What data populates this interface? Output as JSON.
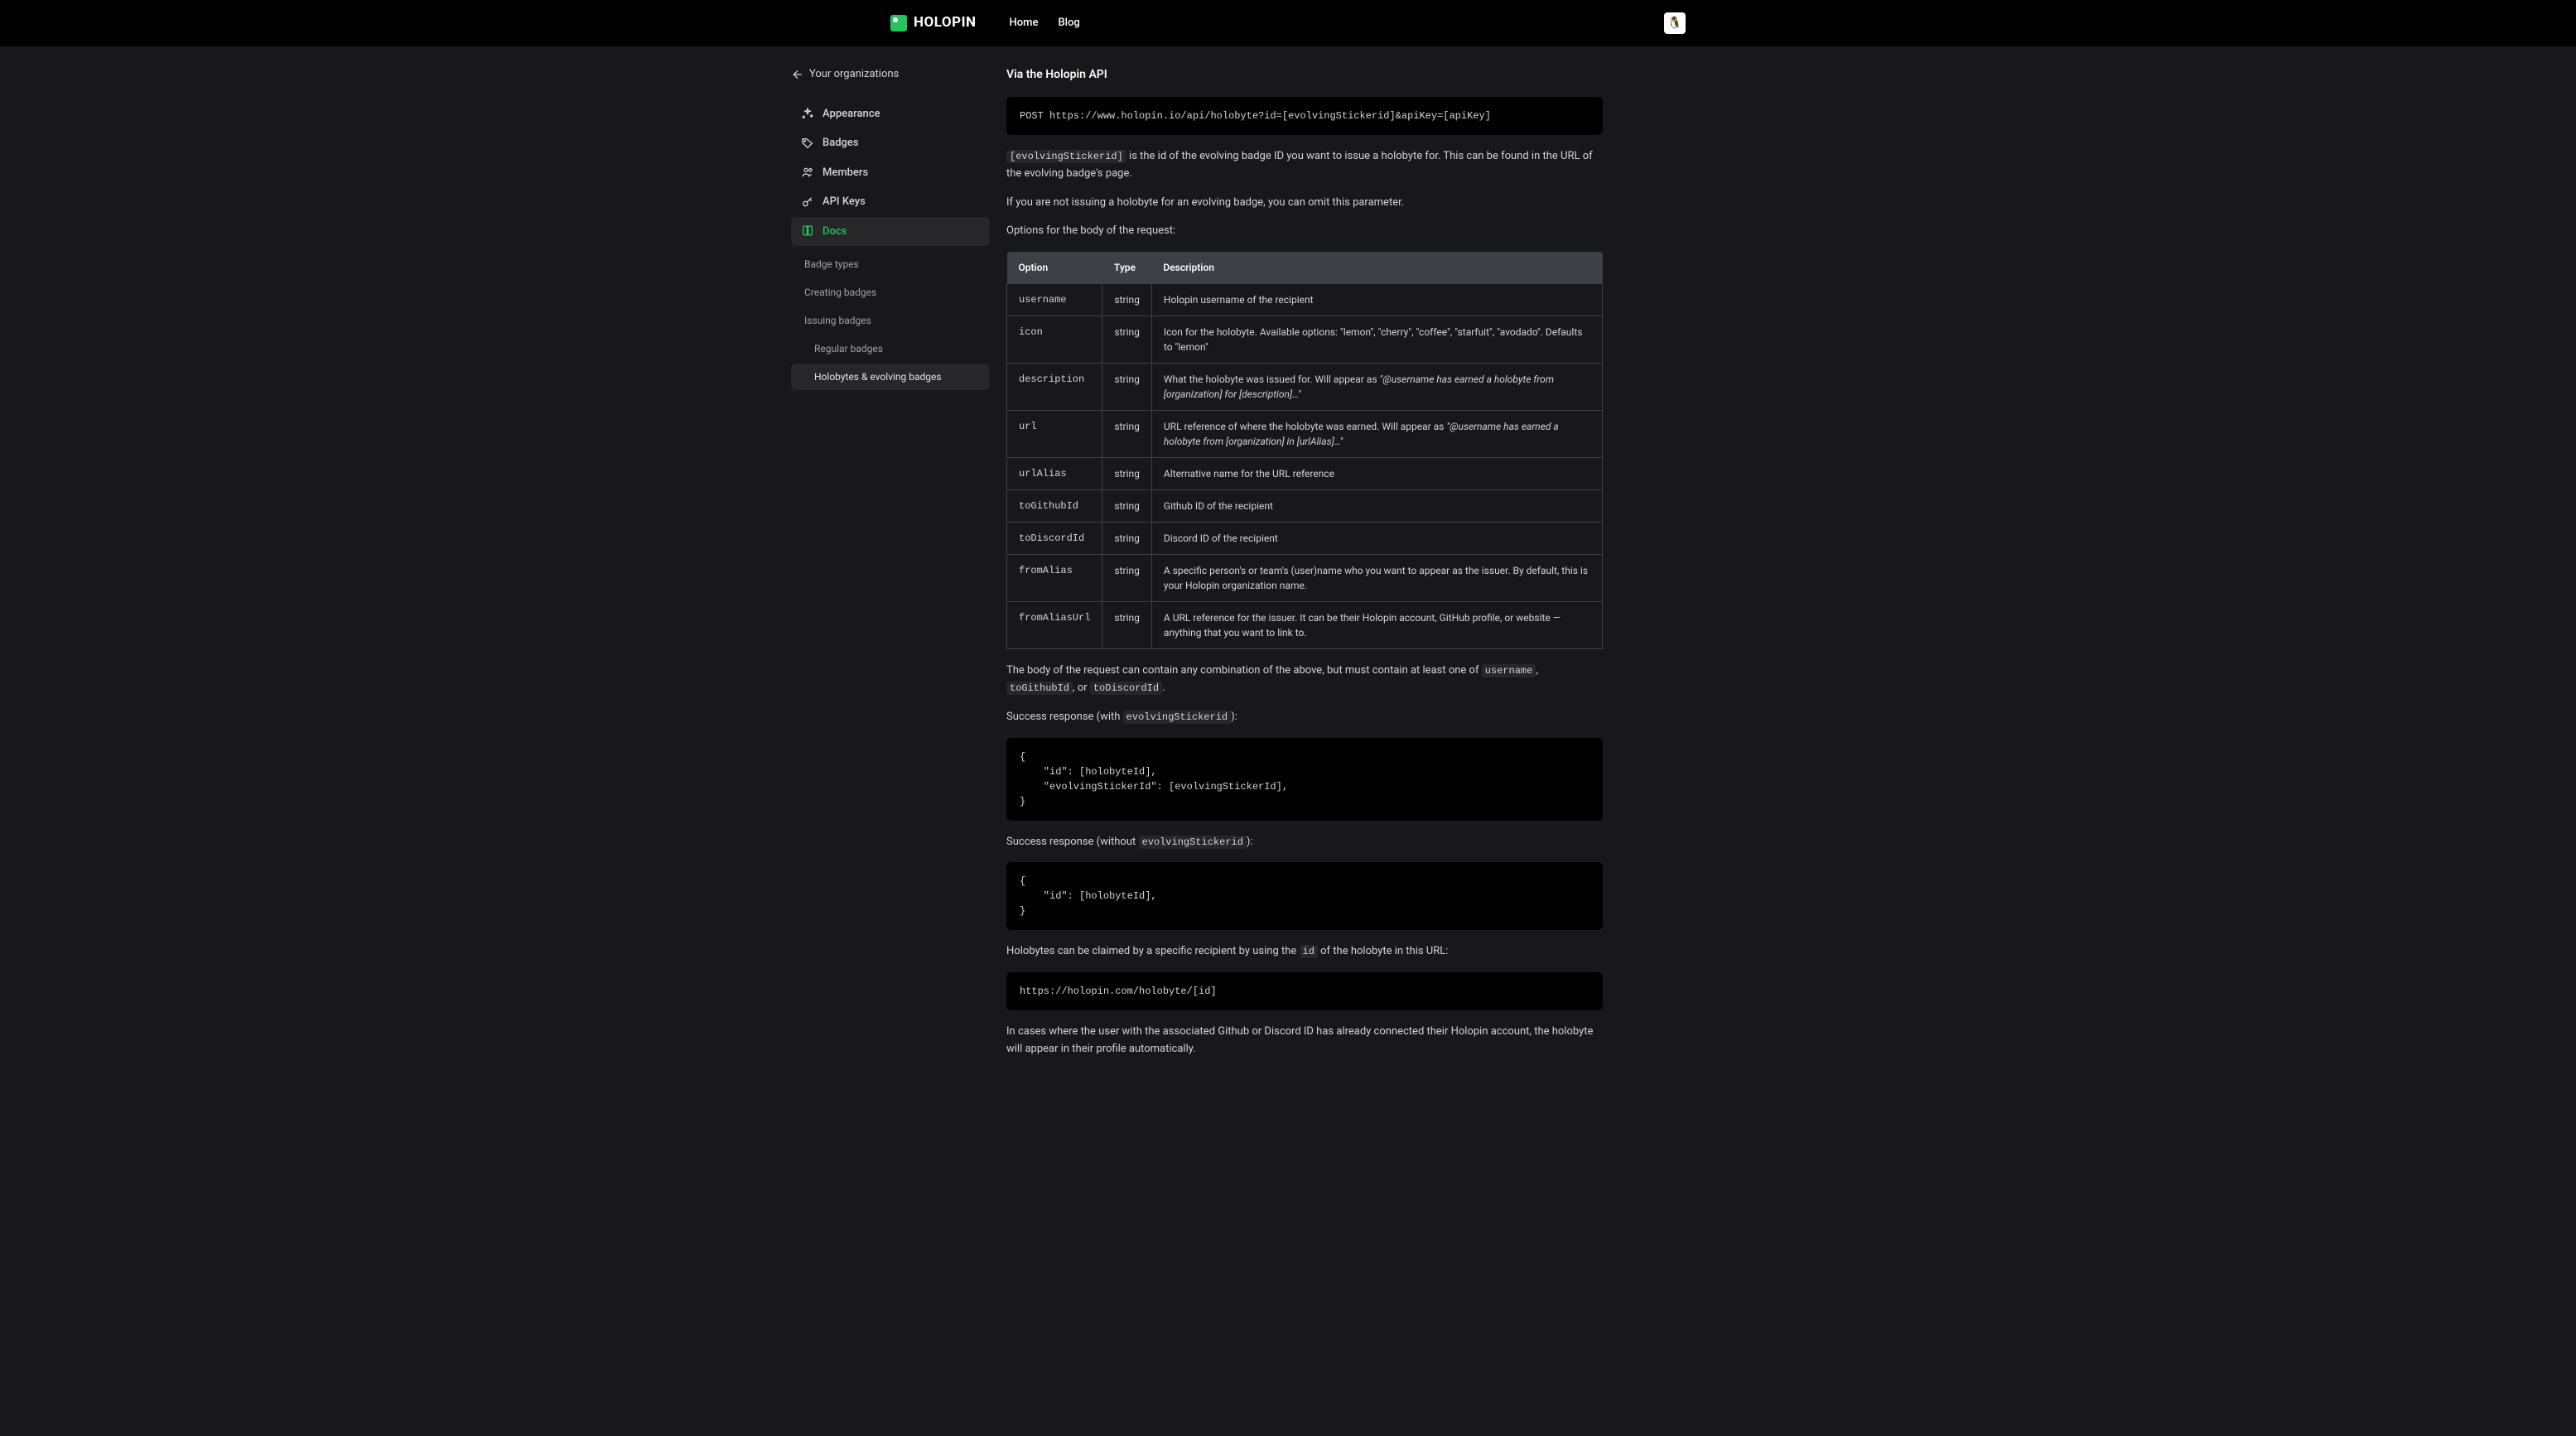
{
  "header": {
    "brand": "HOLOPIN",
    "nav": {
      "home": "Home",
      "blog": "Blog"
    },
    "avatar_emoji": "🐧"
  },
  "sidebar": {
    "back": "Your organizations",
    "items": {
      "appearance": "Appearance",
      "badges": "Badges",
      "members": "Members",
      "apikeys": "API Keys",
      "docs": "Docs"
    },
    "subitems": {
      "badge_types": "Badge types",
      "creating_badges": "Creating badges",
      "issuing_badges": "Issuing badges",
      "regular_badges": "Regular badges",
      "holobytes_evolving": "Holobytes & evolving badges"
    }
  },
  "main": {
    "title": "Via the Holopin API",
    "codeblock1": "POST https://www.holopin.io/api/holobyte?id=[evolvingStickerid]&apiKey=[apiKey]",
    "p1_code": "[evolvingStickerid]",
    "p1_rest": " is the id of the evolving badge ID you want to issue a holobyte for. This can be found in the URL of the evolving badge's page.",
    "p2": "If you are not issuing a holobyte for an evolving badge, you can omit this parameter.",
    "p3": "Options for the body of the request:",
    "table": {
      "headers": {
        "option": "Option",
        "type": "Type",
        "description": "Description"
      },
      "rows": [
        {
          "option": "username",
          "type": "string",
          "desc": "Holopin username of the recipient"
        },
        {
          "option": "icon",
          "type": "string",
          "desc": "Icon for the holobyte. Available options: \"lemon\", \"cherry\", \"coffee\", \"starfuit\", \"avodado\". Defaults to \"lemon\""
        },
        {
          "option": "description",
          "type": "string",
          "desc_lead": "What the holobyte was issued for. Will appear as ",
          "desc_em": "\"@username has earned a holobyte from [organization] for [description]…\""
        },
        {
          "option": "url",
          "type": "string",
          "desc_lead": "URL reference of where the holobyte was earned. Will appear as ",
          "desc_em": "\"@username has earned a holobyte from [organization] in [urlAlias]…\""
        },
        {
          "option": "urlAlias",
          "type": "string",
          "desc": "Alternative name for the URL reference"
        },
        {
          "option": "toGithubId",
          "type": "string",
          "desc": "Github ID of the recipient"
        },
        {
          "option": "toDiscordId",
          "type": "string",
          "desc": "Discord ID of the recipient"
        },
        {
          "option": "fromAlias",
          "type": "string",
          "desc": "A specific person's or team's (user)name who you want to appear as the issuer. By default, this is your Holopin organization name."
        },
        {
          "option": "fromAliasUrl",
          "type": "string",
          "desc": "A URL reference for the issuer. It can be their Holopin account, GitHub profile, or website — anything that you want to link to."
        }
      ]
    },
    "p4_lead": "The body of the request can contain any combination of the above, but must contain at least one of ",
    "p4_c1": "username",
    "p4_mid1": ", ",
    "p4_c2": "toGithubId",
    "p4_mid2": ", or ",
    "p4_c3": "toDiscordId",
    "p4_tail": ".",
    "p5_lead": "Success response (with ",
    "p5_code": "evolvingStickerid",
    "p5_tail": "):",
    "codeblock2": "{\n    \"id\": [holobyteId],\n    \"evolvingStickerId\": [evolvingStickerId],\n}",
    "p6_lead": "Success response (without ",
    "p6_code": "evolvingStickerid",
    "p6_tail": "):",
    "codeblock3": "{\n    \"id\": [holobyteId],\n}",
    "p7_lead": "Holobytes can be claimed by a specific recipient by using the ",
    "p7_code": "id",
    "p7_tail": " of the holobyte in this URL:",
    "codeblock4": "https://holopin.com/holobyte/[id]",
    "p8": "In cases where the user with the associated Github or Discord ID has already connected their Holopin account, the holobyte will appear in their profile automatically."
  }
}
